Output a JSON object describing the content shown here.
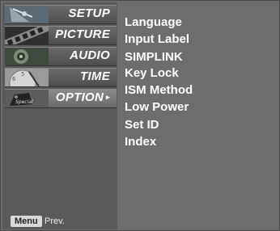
{
  "menu": {
    "tabs": [
      {
        "label": "SETUP",
        "icon": "satellite-dish-icon"
      },
      {
        "label": "PICTURE",
        "icon": "film-strip-icon"
      },
      {
        "label": "AUDIO",
        "icon": "speaker-icon"
      },
      {
        "label": "TIME",
        "icon": "clock-icon"
      },
      {
        "label": "OPTION",
        "icon": "special-tag-icon",
        "selected": true
      }
    ],
    "selected_arrow": "▸"
  },
  "options": {
    "items": [
      "Language",
      "Input Label",
      "SIMPLINK",
      "Key Lock",
      "ISM Method",
      "Low Power",
      "Set ID",
      "Index"
    ]
  },
  "footer": {
    "menu_key": "Menu",
    "prev_label": "Prev."
  },
  "colors": {
    "panel_bg": "#6d6d6d",
    "text": "#ffffff"
  }
}
